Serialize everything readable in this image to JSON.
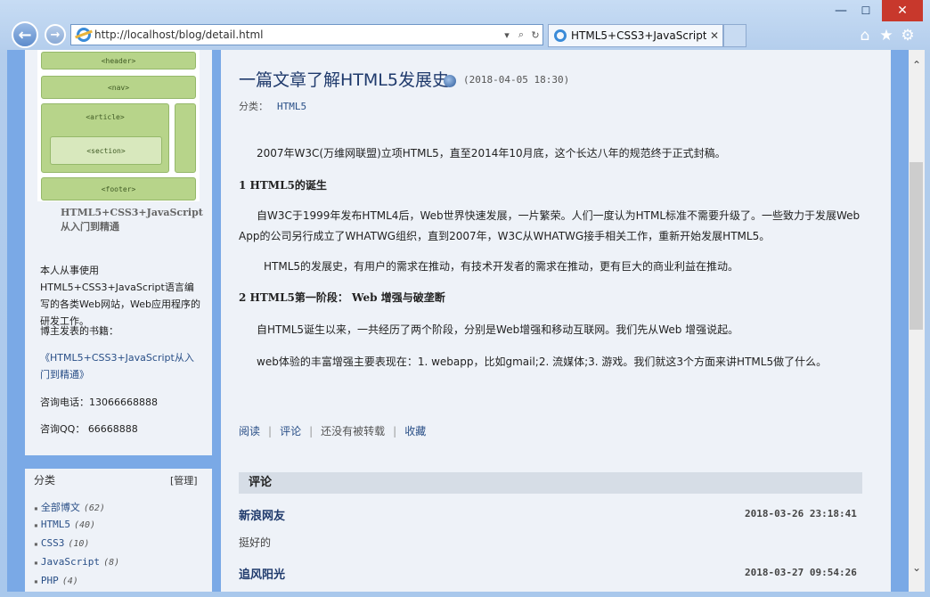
{
  "window": {
    "minimize": "—",
    "maximize": "☐",
    "close": "✕"
  },
  "nav": {
    "back": "←",
    "forward": "→"
  },
  "address": {
    "url": "http://localhost/blog/detail.html",
    "search_glyph": "⌕",
    "refresh_glyph": "↻",
    "dropdown_glyph": "▾"
  },
  "tab": {
    "title": "HTML5+CSS3+JavaScript...",
    "close": "✕"
  },
  "toolbar": {
    "home": "⌂",
    "favorites": "★",
    "tools": "⚙"
  },
  "sidebar": {
    "cover_blocks": {
      "header": "<header>",
      "nav": "<nav>",
      "article": "<article>",
      "section": "<section>",
      "footer": "<footer>"
    },
    "book_title": "HTML5+CSS3+JavaScript",
    "book_sub": "从入门到精通",
    "bio": "本人从事使用HTML5+CSS3+JavaScript语言编写的各类Web网站，Web应用程序的研发工作。",
    "books_heading": "博主发表的书籍：",
    "book_link": "《HTML5+CSS3+JavaScript从入门到精通》",
    "phone": "咨询电话：13066668888",
    "qq": "咨询QQ： 66668888",
    "category": {
      "heading": "分类",
      "manage": "[管理]",
      "items": [
        {
          "label": "全部博文",
          "count": "(62)"
        },
        {
          "label": "HTML5",
          "count": "(40)"
        },
        {
          "label": "CSS3",
          "count": "(10)"
        },
        {
          "label": "JavaScript",
          "count": "(8)"
        },
        {
          "label": "PHP",
          "count": "(4)"
        }
      ]
    }
  },
  "post": {
    "title": "一篇文章了解HTML5发展史",
    "date": "(2018-04-05 18:30)",
    "category_label": "分类：",
    "category_value": "HTML5",
    "p1": "2007年W3C(万维网联盟)立项HTML5，直至2014年10月底，这个长达八年的规范终于正式封稿。",
    "h1": "1 HTML5的诞生",
    "p2": "自W3C于1999年发布HTML4后，Web世界快速发展，一片繁荣。人们一度认为HTML标准不需要升级了。一些致力于发展Web App的公司另行成立了WHATWG组织，直到2007年，W3C从WHATWG接手相关工作，重新开始发展HTML5。",
    "p3": "HTML5的发展史，有用户的需求在推动，有技术开发者的需求在推动，更有巨大的商业利益在推动。",
    "h2": "2 HTML5第一阶段： Web 增强与破垄断",
    "p4": "自HTML5诞生以来，一共经历了两个阶段，分别是Web增强和移动互联网。我们先从Web 增强说起。",
    "p5": "web体验的丰富增强主要表现在：1. webapp，比如gmail;2. 流媒体;3. 游戏。我们就这3个方面来讲HTML5做了什么。",
    "actions": {
      "read": "阅读",
      "comment": "评论",
      "repost": "还没有被转载",
      "favorite": "收藏"
    }
  },
  "comments": {
    "heading": "评论",
    "items": [
      {
        "name": "新浪网友",
        "date": "2018-03-26 23:18:41",
        "body": "挺好的"
      },
      {
        "name": "追风阳光",
        "date": "2018-03-27 09:54:26"
      }
    ]
  },
  "scrollbar": {
    "up": "⌃",
    "down": "⌄"
  }
}
